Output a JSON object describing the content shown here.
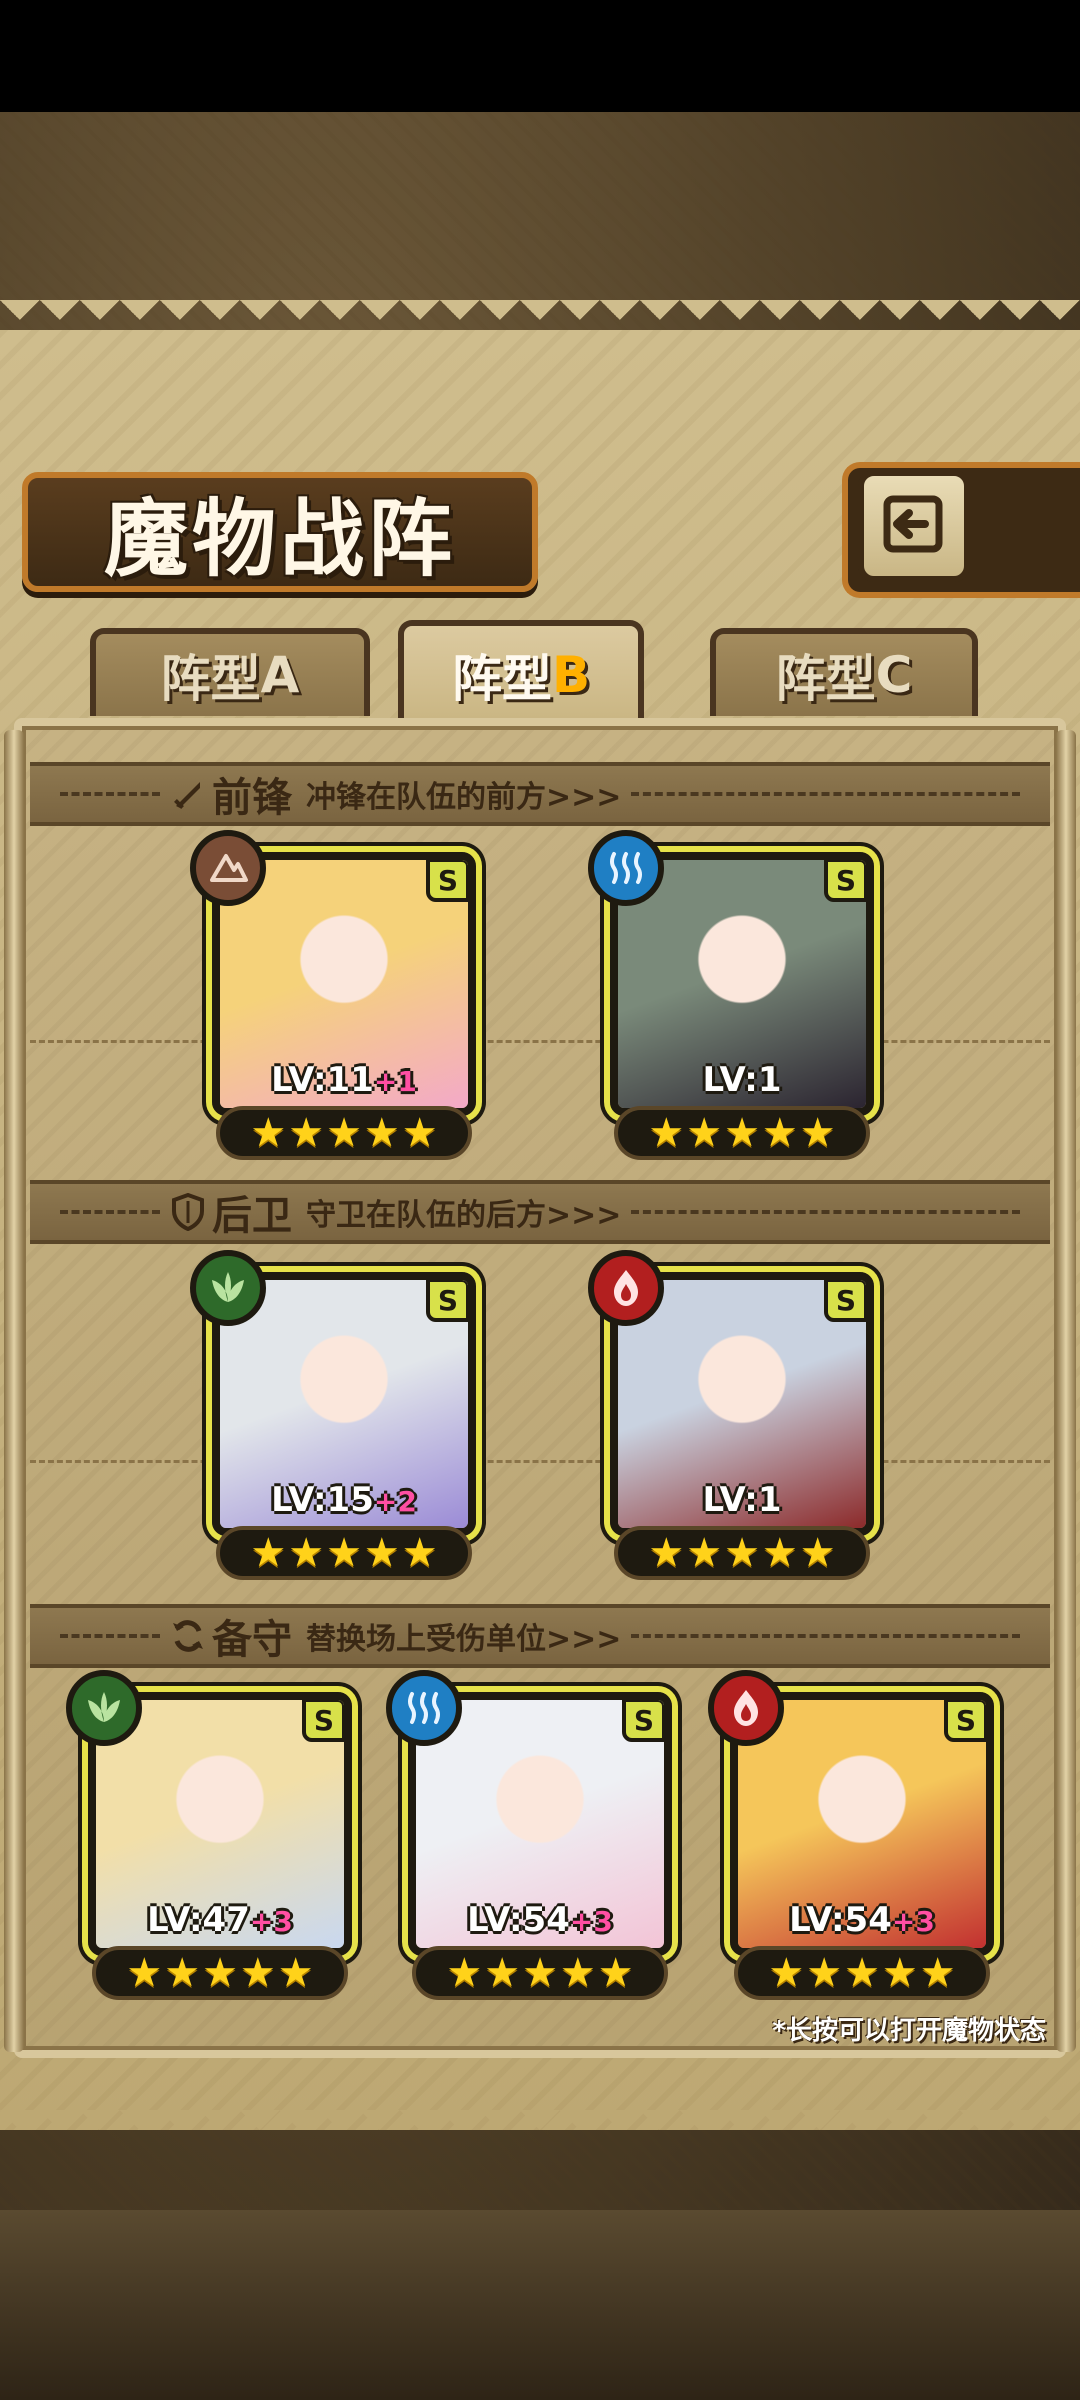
{
  "title": "魔物战阵",
  "tabs": [
    {
      "label": "阵型",
      "letter": "A",
      "active": false
    },
    {
      "label": "阵型",
      "letter": "B",
      "active": true
    },
    {
      "label": "阵型",
      "letter": "C",
      "active": false
    }
  ],
  "sections": {
    "front": {
      "title": "前锋",
      "desc": "冲锋在队伍的前方>>>",
      "icon": "sword-icon"
    },
    "rear": {
      "title": "后卫",
      "desc": "守卫在队伍的后方>>>",
      "icon": "shield-icon"
    },
    "reserve": {
      "title": "备守",
      "desc": "替换场上受伤单位>>>",
      "icon": "swap-icon"
    }
  },
  "cards": [
    {
      "rarity": "S",
      "lv": "LV:11",
      "plus": "+1",
      "element": "earth-element-icon",
      "stars": 5,
      "palette": [
        "#f5d27a",
        "#f3a9c8"
      ]
    },
    {
      "rarity": "S",
      "lv": "LV:1",
      "plus": "",
      "element": "water-element-icon",
      "stars": 5,
      "palette": [
        "#7a8a7a",
        "#2b2430"
      ]
    },
    {
      "rarity": "S",
      "lv": "LV:15",
      "plus": "+2",
      "element": "leaf-element-icon",
      "stars": 5,
      "palette": [
        "#e2e6ea",
        "#9b8bd6"
      ]
    },
    {
      "rarity": "S",
      "lv": "LV:1",
      "plus": "",
      "element": "fire-element-icon",
      "stars": 5,
      "palette": [
        "#c9d2e0",
        "#8c2a2a"
      ]
    },
    {
      "rarity": "S",
      "lv": "LV:47",
      "plus": "+3",
      "element": "leaf-element-icon",
      "stars": 5,
      "palette": [
        "#f2dfa8",
        "#c9d8f0"
      ]
    },
    {
      "rarity": "S",
      "lv": "LV:54",
      "plus": "+3",
      "element": "water-element-icon",
      "stars": 5,
      "palette": [
        "#eef0f4",
        "#f3c4d6"
      ]
    },
    {
      "rarity": "S",
      "lv": "LV:54",
      "plus": "+3",
      "element": "fire-element-icon",
      "stars": 5,
      "palette": [
        "#f5c65a",
        "#c23030"
      ]
    }
  ],
  "hint": "*长按可以打开魔物状态",
  "colors": {
    "accent": "#c07a2a",
    "frame": "#e6e24a",
    "star": "#ffd21a",
    "plus": "#ff4fa3"
  }
}
